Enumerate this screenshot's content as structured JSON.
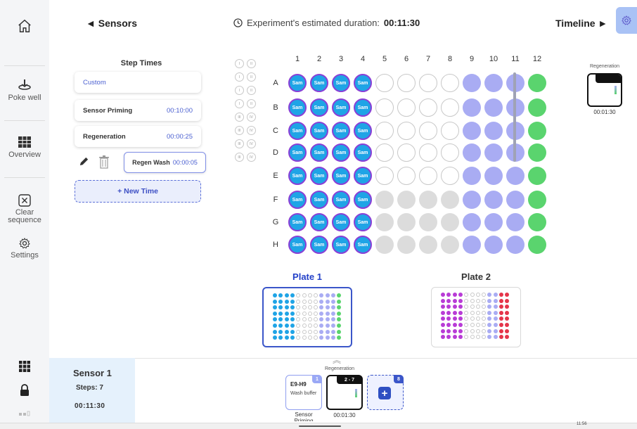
{
  "header": {
    "back_label": "◄ Sensors",
    "duration_label": "Experiment's estimated duration:",
    "duration_value": "00:11:30",
    "forward_label": "Timeline ►"
  },
  "sidebar": {
    "items": [
      {
        "label": "Poke well",
        "icon": "poke-well-icon"
      },
      {
        "label": "Overview",
        "icon": "grid-icon"
      },
      {
        "label": "Clear sequence",
        "icon": "clear-x-icon"
      },
      {
        "label": "Settings",
        "icon": "gear-icon"
      }
    ]
  },
  "step_times": {
    "title": "Step Times",
    "custom_label": "Custom",
    "steps": [
      {
        "name": "Sensor Priming",
        "time": "00:10:00"
      },
      {
        "name": "Regeneration",
        "time": "00:00:25"
      }
    ],
    "editing": {
      "name": "Regen Wash",
      "time": "00:00:05"
    },
    "new_time_label": "+ New Time"
  },
  "plate": {
    "columns": [
      "1",
      "2",
      "3",
      "4",
      "5",
      "6",
      "7",
      "8",
      "9",
      "10",
      "11",
      "12"
    ],
    "rows": [
      "A",
      "B",
      "C",
      "D",
      "E",
      "F",
      "G",
      "H"
    ],
    "well_text": "Sam",
    "roman_numerals": [
      "I",
      "II",
      "I",
      "II",
      "I",
      "II",
      "I",
      "II",
      "III",
      "IV",
      "III",
      "IV",
      "III",
      "IV",
      "III",
      "IV"
    ],
    "regeneration_label": "Regeneration",
    "regeneration_time": "00:01:30"
  },
  "plates": [
    {
      "label": "Plate 1"
    },
    {
      "label": "Plate 2"
    }
  ],
  "sensor_panel": {
    "title": "Sensor 1",
    "steps": "Steps: 7",
    "duration": "00:11:30"
  },
  "sequence": {
    "regeneration_label": "Regeneration",
    "cards": [
      {
        "badge": "1",
        "wells": "E9-H9",
        "buffer": "Wash buffer",
        "label": "Sensor Priming"
      },
      {
        "badge": "2 - 7",
        "label": "00:01:30"
      },
      {
        "badge": "8"
      }
    ]
  },
  "system": {
    "clock": "11:56"
  },
  "colors": {
    "accent": "#3b56c9",
    "sample_fill": "#1fa4e6",
    "sample_border": "#8a3fd6",
    "lavender": "#a9acf3",
    "green": "#5ad46e",
    "gray": "#dcdcdc"
  }
}
